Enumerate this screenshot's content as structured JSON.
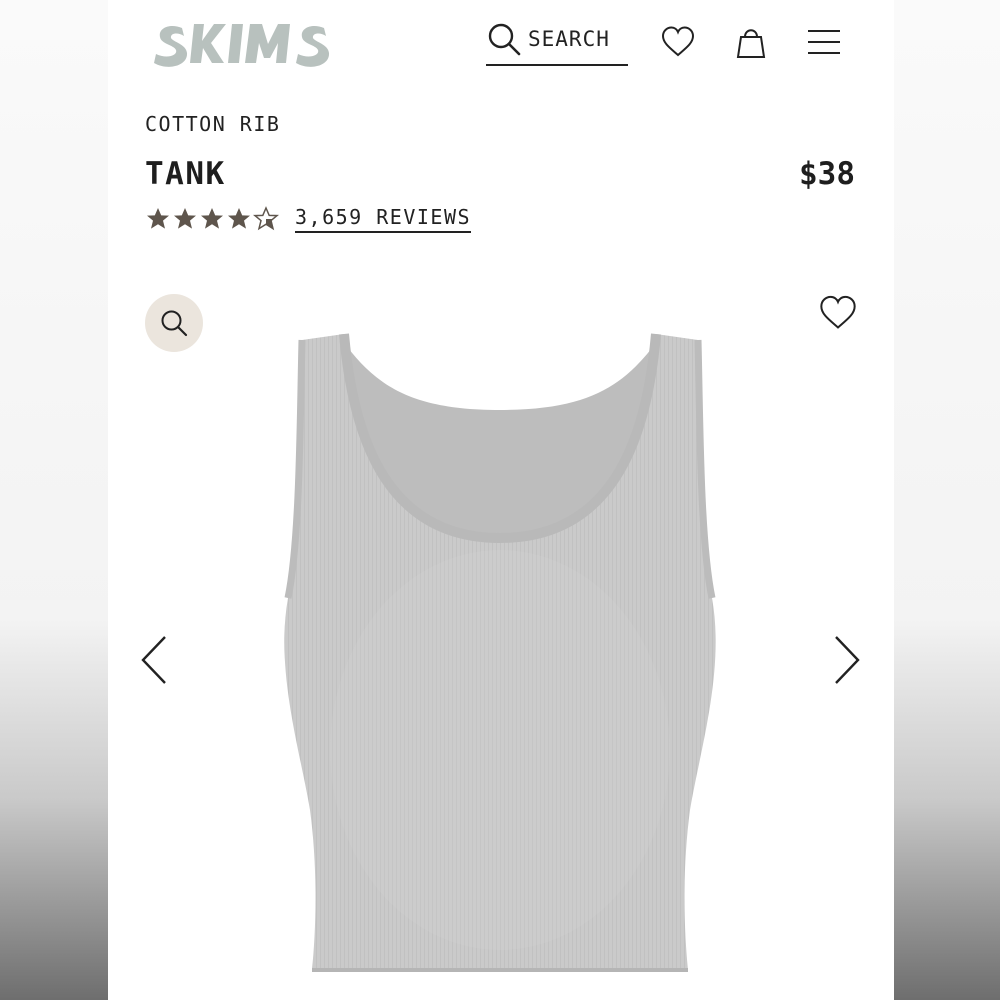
{
  "header": {
    "logo_text": "SKIMS",
    "search_label": "SEARCH",
    "icons": [
      "search-icon",
      "heart-icon",
      "shopping-bag-icon",
      "menu-icon"
    ]
  },
  "product": {
    "category": "COTTON RIB",
    "title": "TANK",
    "price": "$38",
    "rating": 4.5,
    "rating_max": 5,
    "reviews_label": "3,659 REVIEWS"
  },
  "gallery": {
    "icons": [
      "zoom-icon",
      "heart-icon",
      "chevron-left-icon",
      "chevron-right-icon"
    ]
  },
  "colors": {
    "text": "#222222",
    "logo": "#b8c1be",
    "stars": "#5e554c",
    "zoom_button_bg": "#ebe5dd",
    "product_gray": "#c9c9c9"
  }
}
